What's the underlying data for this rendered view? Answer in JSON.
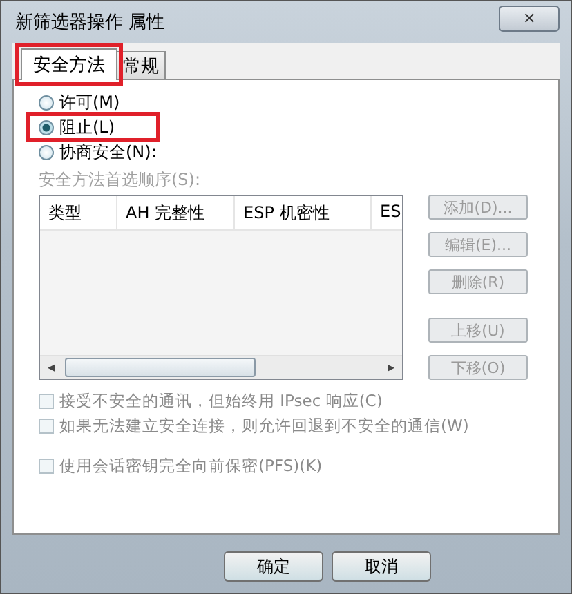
{
  "window": {
    "title": "新筛选器操作 属性",
    "close": "✕"
  },
  "tabs": [
    {
      "label": "安全方法",
      "selected": true,
      "highlighted": true
    },
    {
      "label": "常规",
      "selected": false,
      "highlighted": false
    }
  ],
  "radios": [
    {
      "label": "许可(M)",
      "selected": false,
      "highlighted": false
    },
    {
      "label": "阻止(L)",
      "selected": true,
      "highlighted": true
    },
    {
      "label": "协商安全(N):",
      "selected": false,
      "highlighted": false
    }
  ],
  "methods": {
    "label": "安全方法首选顺序(S):",
    "disabled": true,
    "columns": [
      "类型",
      "AH 完整性",
      "ESP 机密性",
      "ES"
    ],
    "scroll_left": "◂",
    "scroll_right": "▸",
    "buttons": [
      {
        "label": "添加(D)...",
        "disabled": true
      },
      {
        "label": "编辑(E)...",
        "disabled": true
      },
      {
        "label": "删除(R)",
        "disabled": true
      },
      {
        "label": "上移(U)",
        "disabled": true
      },
      {
        "label": "下移(O)",
        "disabled": true
      }
    ]
  },
  "checkboxes": [
    {
      "label": "接受不安全的通讯，但始终用 IPsec 响应(C)",
      "checked": false,
      "disabled": true
    },
    {
      "label": "如果无法建立安全连接，则允许回退到不安全的通信(W)",
      "checked": false,
      "disabled": true
    },
    {
      "label": "使用会话密钥完全向前保密(PFS)(K)",
      "checked": false,
      "disabled": true
    }
  ],
  "buttons": [
    "确定",
    "取消"
  ]
}
